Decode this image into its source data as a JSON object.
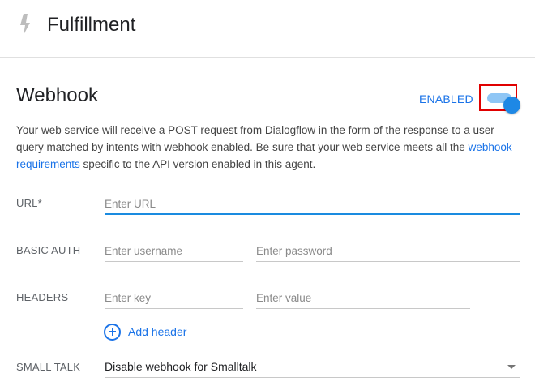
{
  "header": {
    "icon": "bolt-icon",
    "title": "Fulfillment"
  },
  "webhook": {
    "title": "Webhook",
    "status_label": "ENABLED",
    "toggle_on": true,
    "description": {
      "before_link": "Your web service will receive a POST request from Dialogflow in the form of the response to a user query matched by intents with webhook enabled. Be sure that your web service meets all the ",
      "link_text": "webhook requirements",
      "after_link": " specific to the API version enabled in this agent."
    },
    "url": {
      "label": "URL*",
      "value": "",
      "placeholder": "Enter URL"
    },
    "basic_auth": {
      "label": "BASIC AUTH",
      "username_placeholder": "Enter username",
      "password_placeholder": "Enter password"
    },
    "headers": {
      "label": "HEADERS",
      "key_placeholder": "Enter key",
      "value_placeholder": "Enter value",
      "add_label": "Add header",
      "add_icon": "add-circle-icon"
    },
    "small_talk": {
      "label": "SMALL TALK",
      "selected": "Disable webhook for Smalltalk"
    }
  },
  "colors": {
    "accent": "#1a73e8",
    "toggle_thumb": "#1e88e5",
    "toggle_track": "#8fc6f5",
    "highlight_box": "#e00000"
  }
}
